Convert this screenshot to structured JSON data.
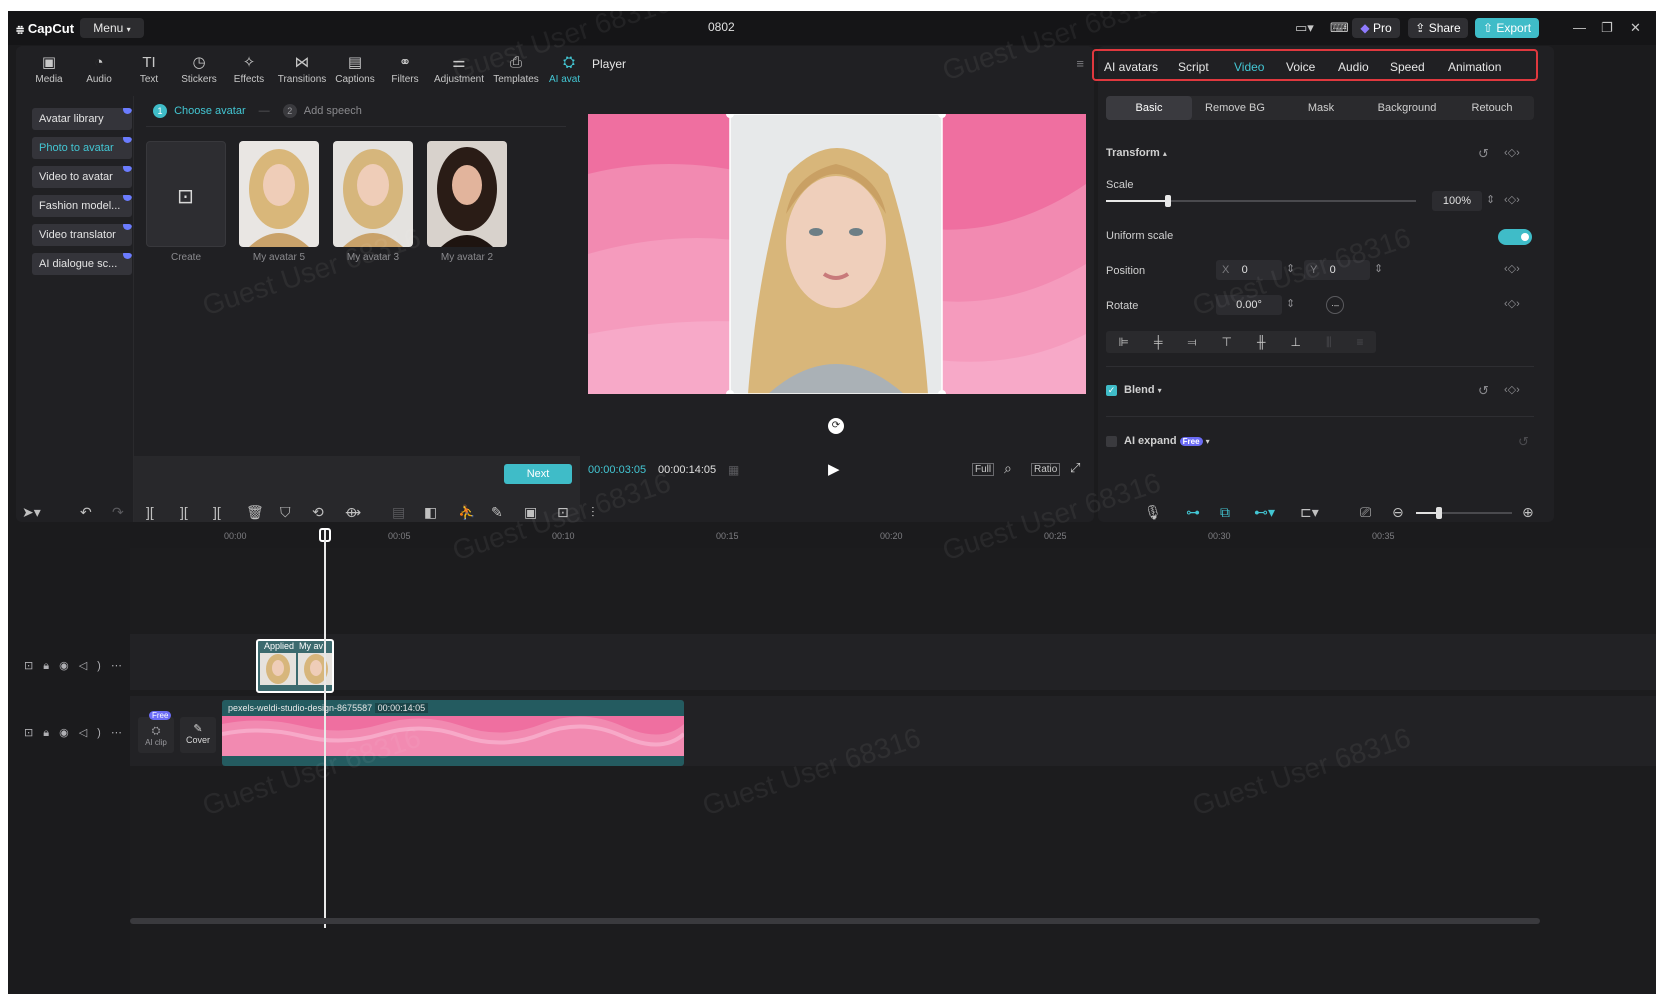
{
  "app": {
    "logo": "CapCut",
    "menu_label": "Menu",
    "project_title": "0802",
    "pro_label": "Pro",
    "share_label": "Share",
    "export_label": "Export",
    "accent_color": "#43c6d3",
    "export_color": "#3fbcc8"
  },
  "tools": [
    {
      "label": "Media",
      "icon": "media-icon"
    },
    {
      "label": "Audio",
      "icon": "audio-icon"
    },
    {
      "label": "Text",
      "icon": "text-icon"
    },
    {
      "label": "Stickers",
      "icon": "stickers-icon"
    },
    {
      "label": "Effects",
      "icon": "effects-icon"
    },
    {
      "label": "Transitions",
      "icon": "transitions-icon"
    },
    {
      "label": "Captions",
      "icon": "captions-icon"
    },
    {
      "label": "Filters",
      "icon": "filters-icon"
    },
    {
      "label": "Adjustment",
      "icon": "adjustment-icon"
    },
    {
      "label": "Templates",
      "icon": "templates-icon"
    },
    {
      "label": "AI avatar",
      "icon": "ai-avatar-icon"
    }
  ],
  "sidebar": {
    "items": [
      {
        "label": "Avatar library"
      },
      {
        "label": "Photo to avatar"
      },
      {
        "label": "Video to avatar"
      },
      {
        "label": "Fashion model..."
      },
      {
        "label": "Video translator"
      },
      {
        "label": "AI dialogue sc..."
      }
    ]
  },
  "steps": [
    {
      "num": "1",
      "label": "Choose avatar"
    },
    {
      "num": "2",
      "label": "Add speech"
    }
  ],
  "avatars": [
    {
      "label": "Create"
    },
    {
      "label": "My avatar 5"
    },
    {
      "label": "My avatar 3"
    },
    {
      "label": "My avatar 2"
    }
  ],
  "next_label": "Next",
  "player": {
    "title": "Player",
    "current_time": "00:00:03:05",
    "duration": "00:00:14:05",
    "full_label": "Full",
    "ratio_label": "Ratio"
  },
  "right_tabs": [
    "AI avatars",
    "Script",
    "Video",
    "Voice",
    "Audio",
    "Speed",
    "Animation"
  ],
  "sub_tabs": [
    "Basic",
    "Remove BG",
    "Mask",
    "Background",
    "Retouch"
  ],
  "props": {
    "transform": "Transform",
    "scale": "Scale",
    "scale_value": "100%",
    "scale_fraction": 0.2,
    "uniform_scale": "Uniform scale",
    "position": "Position",
    "pos_x_label": "X",
    "pos_x": "0",
    "pos_y_label": "Y",
    "pos_y": "0",
    "rotate": "Rotate",
    "rotate_value": "0.00°",
    "blend": "Blend",
    "ai_expand": "AI expand",
    "free_badge": "Free"
  },
  "ruler": [
    "00:00",
    "00:05",
    "00:10",
    "00:15",
    "00:20",
    "00:25",
    "00:30",
    "00:35"
  ],
  "clips": {
    "avatar_clip_label": "Applied",
    "avatar_clip_name": "My av",
    "video_clip_name": "pexels-weldi-studio-design-8675587",
    "video_clip_duration": "00:00:14:05",
    "ai_clip_label": "AI clip",
    "free_badge": "Free",
    "cover_label": "Cover"
  },
  "watermark": "Guest User 68316"
}
